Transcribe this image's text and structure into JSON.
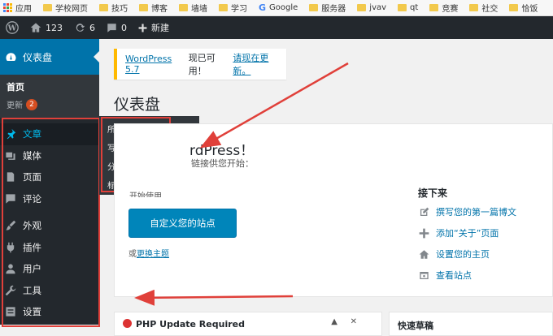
{
  "bookmarks": [
    {
      "label": "应用",
      "icon": "apps-icon"
    },
    {
      "label": "学校网页",
      "icon": "folder-icon"
    },
    {
      "label": "技巧",
      "icon": "folder-icon"
    },
    {
      "label": "博客",
      "icon": "folder-icon"
    },
    {
      "label": "墙墙",
      "icon": "folder-icon"
    },
    {
      "label": "学习",
      "icon": "folder-icon"
    },
    {
      "label": "Google",
      "icon": "google-icon"
    },
    {
      "label": "服务器",
      "icon": "folder-icon"
    },
    {
      "label": "jvav",
      "icon": "folder-icon"
    },
    {
      "label": "qt",
      "icon": "folder-icon"
    },
    {
      "label": "竞赛",
      "icon": "folder-icon"
    },
    {
      "label": "社交",
      "icon": "folder-icon"
    },
    {
      "label": "恰饭",
      "icon": "folder-icon"
    }
  ],
  "adminbar": {
    "site_name": "123",
    "updates_count": "6",
    "comments_count": "0",
    "new_label": "新建"
  },
  "sidebar": {
    "dashboard_label": "仪表盘",
    "sub_home": "首页",
    "sub_updates": "更新",
    "updates_badge": "2",
    "items": [
      {
        "label": "文章",
        "icon": "pushpin-icon"
      },
      {
        "label": "媒体",
        "icon": "media-icon"
      },
      {
        "label": "页面",
        "icon": "page-icon"
      },
      {
        "label": "评论",
        "icon": "comment-icon"
      },
      {
        "label": "外观",
        "icon": "brush-icon"
      },
      {
        "label": "插件",
        "icon": "plugin-icon"
      },
      {
        "label": "用户",
        "icon": "user-icon"
      },
      {
        "label": "工具",
        "icon": "wrench-icon"
      },
      {
        "label": "设置",
        "icon": "settings-icon"
      }
    ]
  },
  "flyout": [
    "所有文章",
    "写文章",
    "分类目录",
    "标签"
  ],
  "notice": {
    "version_link": "WordPress 5.7",
    "text": "现已可用！",
    "update_link": "请现在更新。"
  },
  "page_title": "仪表盘",
  "welcome": {
    "title_partial": "rdPress！",
    "subtitle_partial": "链接供您开始：",
    "hidden_heading_partial": "开始使用",
    "customize_button": "自定义您的站点",
    "or_text": "或",
    "change_theme_link": "更换主题",
    "next_heading": "接下来",
    "next_items": [
      {
        "label": "撰写您的第一篇博文",
        "icon": "edit-icon"
      },
      {
        "label": "添加“关于”页面",
        "icon": "plus-icon"
      },
      {
        "label": "设置您的主页",
        "icon": "home-icon"
      },
      {
        "label": "查看站点",
        "icon": "view-icon"
      }
    ]
  },
  "php_box": {
    "title": "PHP Update Required"
  },
  "quick_box": {
    "title": "快速草稿"
  },
  "colors": {
    "accent": "#0073aa",
    "annotation_red": "#e0403a",
    "adminbar": "#23282d"
  }
}
